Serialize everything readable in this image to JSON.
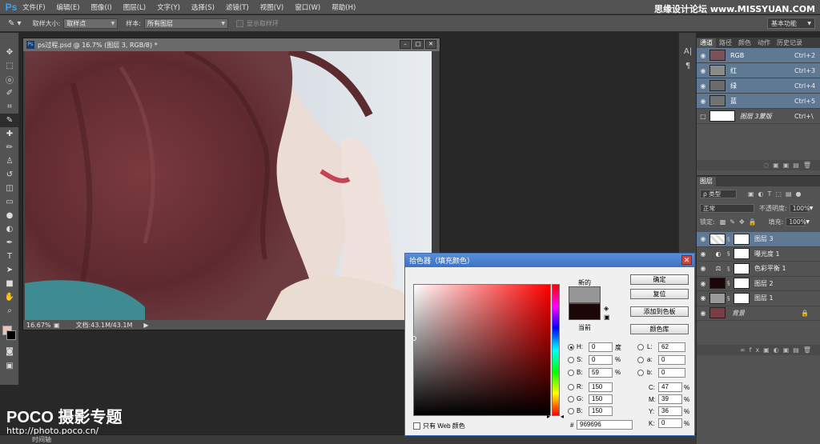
{
  "app": {
    "logo": "Ps",
    "watermark": "思缘设计论坛 www.MISSYUAN.COM"
  },
  "menu": [
    "文件(F)",
    "编辑(E)",
    "图像(I)",
    "图层(L)",
    "文字(Y)",
    "选择(S)",
    "滤镜(T)",
    "视图(V)",
    "窗口(W)",
    "帮助(H)"
  ],
  "options": {
    "sample_size_label": "取样大小:",
    "sample_size": "取样点",
    "sample_label": "样本:",
    "sample": "所有图层",
    "show_ring": "显示取样环",
    "workspace": "基本功能"
  },
  "document": {
    "title": "ps过程.psd @ 16.7% (图层 3, RGB/8) *",
    "zoom": "16.67%",
    "info": "文档:43.1M/43.1M"
  },
  "bottom": {
    "timeline": "时间轴"
  },
  "poco": {
    "brand": "POCO 摄影专题",
    "url": "http://photo.poco.cn/"
  },
  "channels": {
    "tabs": [
      "通道",
      "路径",
      "颜色",
      "动作",
      "历史记录"
    ],
    "rows": [
      {
        "name": "RGB",
        "shortcut": "Ctrl+2"
      },
      {
        "name": "红",
        "shortcut": "Ctrl+3"
      },
      {
        "name": "绿",
        "shortcut": "Ctrl+4"
      },
      {
        "name": "蓝",
        "shortcut": "Ctrl+5"
      },
      {
        "name": "图层 3蒙版",
        "shortcut": "Ctrl+\\"
      }
    ]
  },
  "layers": {
    "tab": "图层",
    "kind": "ρ 类型",
    "blend": "正常",
    "opacity_label": "不透明度:",
    "opacity": "100%",
    "lock_label": "锁定:",
    "fill_label": "填充:",
    "fill": "100%",
    "items": [
      {
        "name": "图层 3"
      },
      {
        "name": "曝光度 1"
      },
      {
        "name": "色彩平衡 1"
      },
      {
        "name": "图层 2"
      },
      {
        "name": "图层 1"
      },
      {
        "name": "背景"
      }
    ]
  },
  "picker": {
    "title": "拾色器（填充颜色）",
    "new_label": "新的",
    "current_label": "当前",
    "ok": "确定",
    "reset": "复位",
    "add_swatch": "添加到色板",
    "libraries": "颜色库",
    "web_only": "只有 Web 颜色",
    "H": "0",
    "H_unit": "度",
    "S": "0",
    "S_unit": "%",
    "B": "59",
    "B_unit": "%",
    "R": "150",
    "G": "150",
    "Bl": "150",
    "L": "62",
    "a": "0",
    "b": "0",
    "C": "47",
    "M": "39",
    "Y": "36",
    "K": "0",
    "pct": "%",
    "hash": "#",
    "hex": "969696",
    "labels": {
      "H": "H:",
      "S": "S:",
      "B": "B:",
      "R": "R:",
      "G": "G:",
      "Bl": "B:",
      "L": "L:",
      "a": "a:",
      "b": "b:",
      "C": "C:",
      "M": "M:",
      "Y": "Y:",
      "K": "K:"
    }
  },
  "colors": {
    "selection": "#5f7894",
    "new_color": "#969696",
    "current_color": "#1b0707",
    "foreground": "#e9c5b6"
  }
}
